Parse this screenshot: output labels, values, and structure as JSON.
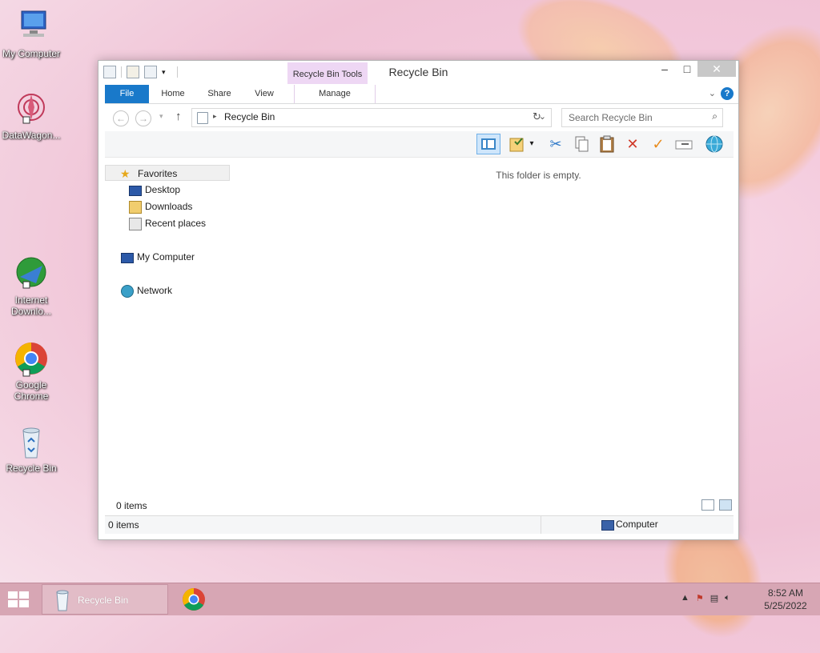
{
  "desktop": {
    "icons": [
      {
        "label": "My Computer"
      },
      {
        "label": "DataWagon..."
      },
      {
        "label": "Internet Downlo..."
      },
      {
        "label": "Google Chrome"
      },
      {
        "label": "Recycle Bin"
      }
    ]
  },
  "window": {
    "title": "Recycle Bin",
    "context_tab": "Recycle Bin Tools",
    "ribbon_tabs": {
      "file": "File",
      "home": "Home",
      "share": "Share",
      "view": "View",
      "manage": "Manage"
    },
    "help": "?",
    "address": "Recycle Bin",
    "search_placeholder": "Search Recycle Bin",
    "nav": {
      "favorites": "Favorites",
      "desktop": "Desktop",
      "downloads": "Downloads",
      "recent": "Recent places",
      "computer": "My Computer",
      "network": "Network"
    },
    "empty_message": "This folder is empty.",
    "items_count": "0 items",
    "status_items": "0 items",
    "status_location": "Computer"
  },
  "taskbar": {
    "app_label": "Recycle Bin",
    "time": "8:52 AM",
    "date": "5/25/2022"
  }
}
